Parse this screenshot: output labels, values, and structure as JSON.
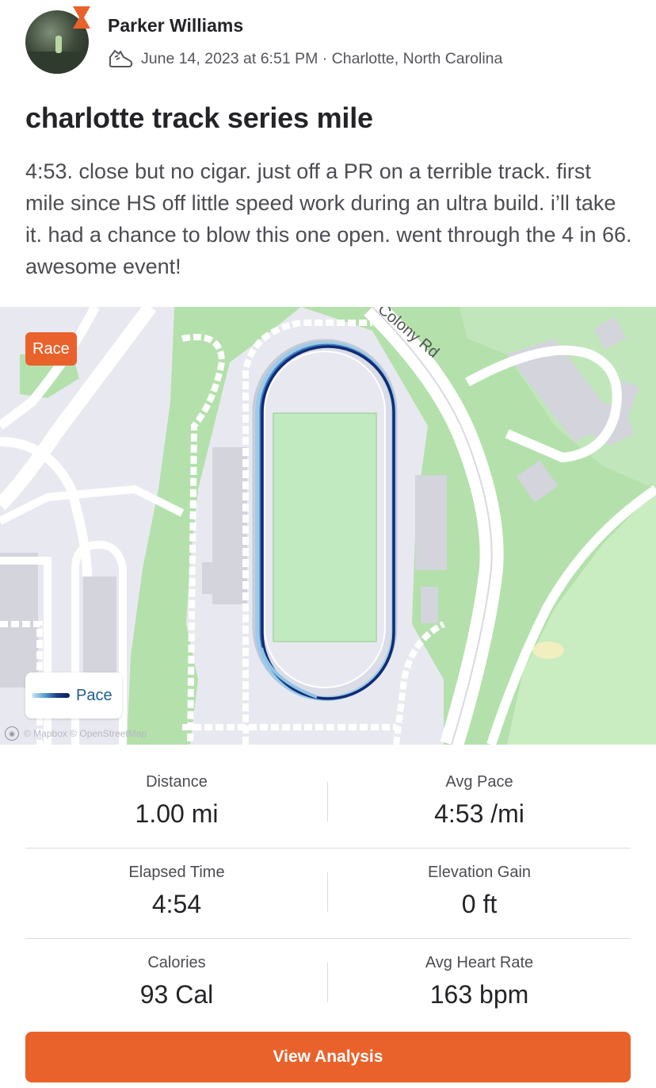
{
  "header": {
    "athlete_name": "Parker Williams",
    "meta_text": "June 14, 2023 at 6:51 PM · Charlotte, North Carolina"
  },
  "activity": {
    "title": "charlotte track series mile",
    "description": "4:53. close but no cigar. just off a PR on a terrible track. first mile since HS off little speed work during an ultra build. i’ll take it. had a chance to blow this one open. went through the 4 in 66. awesome event!"
  },
  "map": {
    "tag": "Race",
    "road_label": "Colony Rd",
    "legend_label": "Pace",
    "attribution": "© Mapbox © OpenStreetMap"
  },
  "stats": [
    {
      "left": {
        "label": "Distance",
        "value": "1.00 mi"
      },
      "right": {
        "label": "Avg Pace",
        "value": "4:53 /mi"
      }
    },
    {
      "left": {
        "label": "Elapsed Time",
        "value": "4:54"
      },
      "right": {
        "label": "Elevation Gain",
        "value": "0 ft"
      }
    },
    {
      "left": {
        "label": "Calories",
        "value": "93 Cal"
      },
      "right": {
        "label": "Avg Heart Rate",
        "value": "163 bpm"
      }
    }
  ],
  "actions": {
    "view_analysis": "View Analysis"
  },
  "colors": {
    "brand": "#e9622c",
    "text": "#242428",
    "muted": "#4c4c52",
    "park": "#a9dca0",
    "water": "#c7d8ea"
  },
  "icons": {
    "badge": "strava-badge-icon",
    "activity_type": "running-shoe-icon"
  }
}
